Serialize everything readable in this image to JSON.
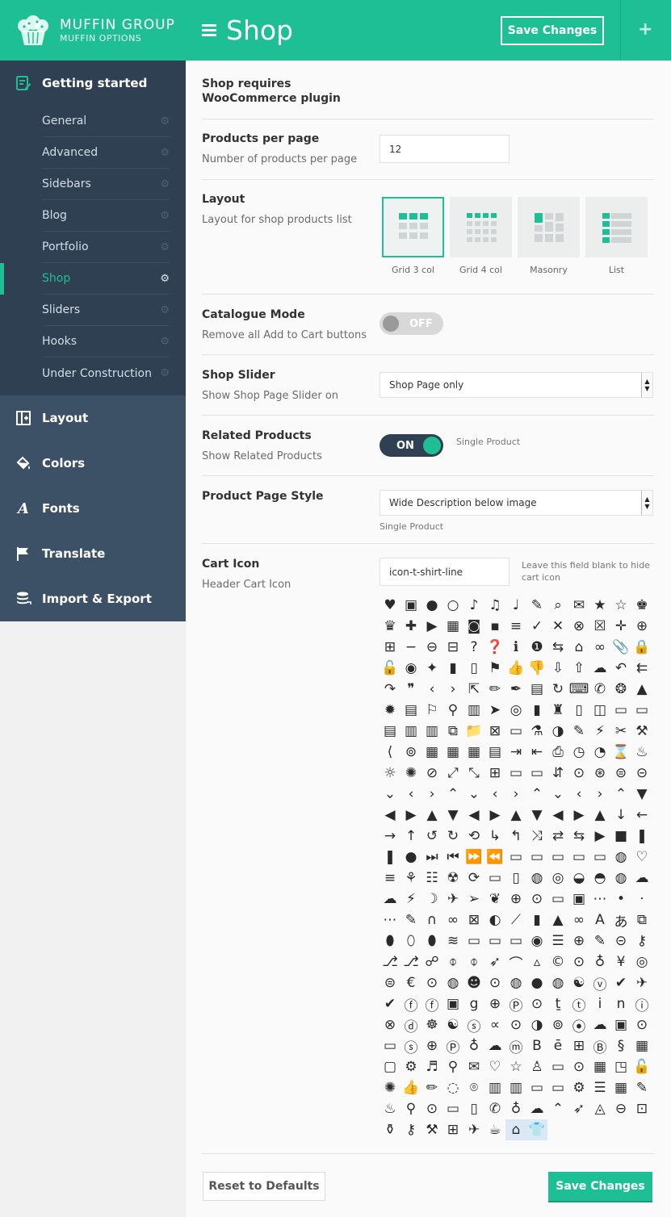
{
  "brand": {
    "name": "MUFFIN GROUP",
    "sub": "MUFFIN OPTIONS"
  },
  "sidebar": {
    "getting_started": "Getting started",
    "items": [
      {
        "label": "General",
        "active": false
      },
      {
        "label": "Advanced",
        "active": false
      },
      {
        "label": "Sidebars",
        "active": false
      },
      {
        "label": "Blog",
        "active": false
      },
      {
        "label": "Portfolio",
        "active": false
      },
      {
        "label": "Shop",
        "active": true
      },
      {
        "label": "Sliders",
        "active": false
      },
      {
        "label": "Hooks",
        "active": false
      },
      {
        "label": "Under Construction",
        "active": false
      }
    ],
    "sections": [
      "Layout",
      "Colors",
      "Fonts",
      "Translate",
      "Import & Export"
    ]
  },
  "header": {
    "title": "Shop",
    "save_label": "Save Changes",
    "plus": "+"
  },
  "shop_notice": {
    "line1": "Shop requires",
    "line2": "WooCommerce plugin"
  },
  "products_per_page": {
    "label": "Products per page",
    "desc": "Number of products per page",
    "value": "12"
  },
  "layout": {
    "label": "Layout",
    "desc": "Layout for shop products list",
    "options": [
      {
        "label": "Grid 3 col",
        "selected": true
      },
      {
        "label": "Grid 4 col",
        "selected": false
      },
      {
        "label": "Masonry",
        "selected": false
      },
      {
        "label": "List",
        "selected": false
      }
    ]
  },
  "catalogue_mode": {
    "label": "Catalogue Mode",
    "desc": "Remove all Add to Cart buttons",
    "state": "OFF"
  },
  "shop_slider": {
    "label": "Shop Slider",
    "desc": "Show Shop Page Slider on",
    "value": "Shop Page only"
  },
  "related_products": {
    "label": "Related Products",
    "desc": "Show Related Products",
    "state": "ON",
    "note": "Single Product"
  },
  "product_page_style": {
    "label": "Product Page Style",
    "value": "Wide Description below image",
    "note": "Single Product"
  },
  "cart_icon": {
    "label": "Cart Icon",
    "desc": "Header Cart Icon",
    "value": "icon-t-shirt-line",
    "note_line1": "Leave this field blank to hide",
    "note_line2": "cart icon"
  },
  "footer": {
    "reset_label": "Reset to Defaults",
    "save_label": "Save Changes"
  },
  "colors": {
    "accent": "#1fbf96",
    "sidebar_dark": "#2e4052",
    "sidebar_mid": "#3c5166"
  }
}
